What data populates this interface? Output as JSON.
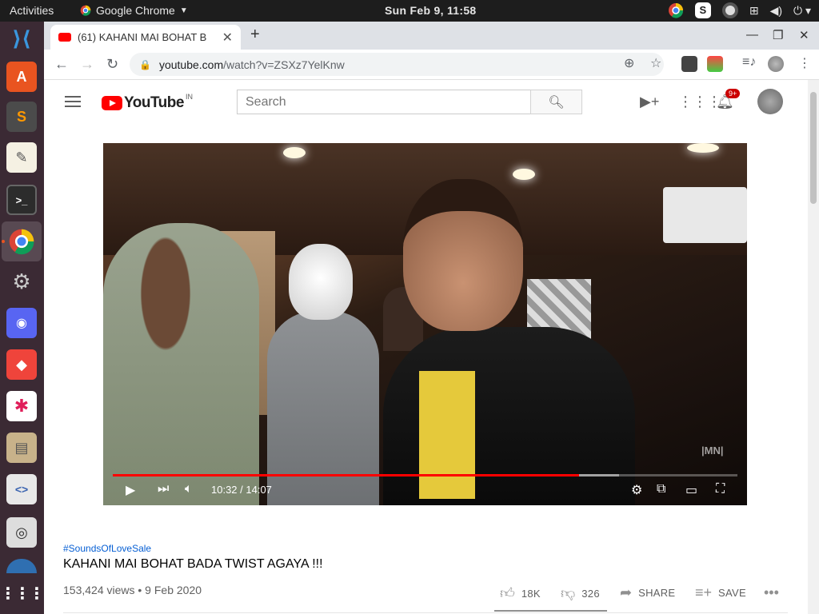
{
  "topbar": {
    "activities": "Activities",
    "app_name": "Google Chrome",
    "clock": "Sun Feb  9, 11:58"
  },
  "dock": {
    "items": [
      "visual-studio-code",
      "ubuntu-software",
      "sublime-text",
      "text-editor",
      "terminal",
      "google-chrome",
      "settings",
      "discord",
      "anydesk",
      "slack",
      "file-cabinet",
      "code-editor",
      "screenshot",
      "partial-app",
      "show-applications"
    ]
  },
  "browser": {
    "tab_title": "(61) KAHANI MAI BOHAT B",
    "url_host": "youtube.com",
    "url_path": "/watch?v=ZSXz7YelKnw"
  },
  "youtube": {
    "logo_text": "YouTube",
    "country_code": "IN",
    "search_placeholder": "Search",
    "notification_count": "9+",
    "player": {
      "time_current": "10:32",
      "time_total": "14:07",
      "time_display": "10:32 / 14:07",
      "progress_played": 0.746,
      "progress_loaded": 0.81,
      "watermark": "|MN|"
    },
    "video": {
      "hashtag": "#SoundsOfLoveSale",
      "title": "KAHANI MAI BOHAT BADA TWIST AGAYA !!!",
      "meta": "153,424 views • 9 Feb 2020",
      "likes": "18K",
      "dislikes": "326",
      "share": "SHARE",
      "save": "SAVE"
    }
  },
  "colors": {
    "yt_red": "#ff0000",
    "link_blue": "#065fd4",
    "dock_bg": "#3b2a34",
    "topbar_bg": "#1d1d1d"
  }
}
